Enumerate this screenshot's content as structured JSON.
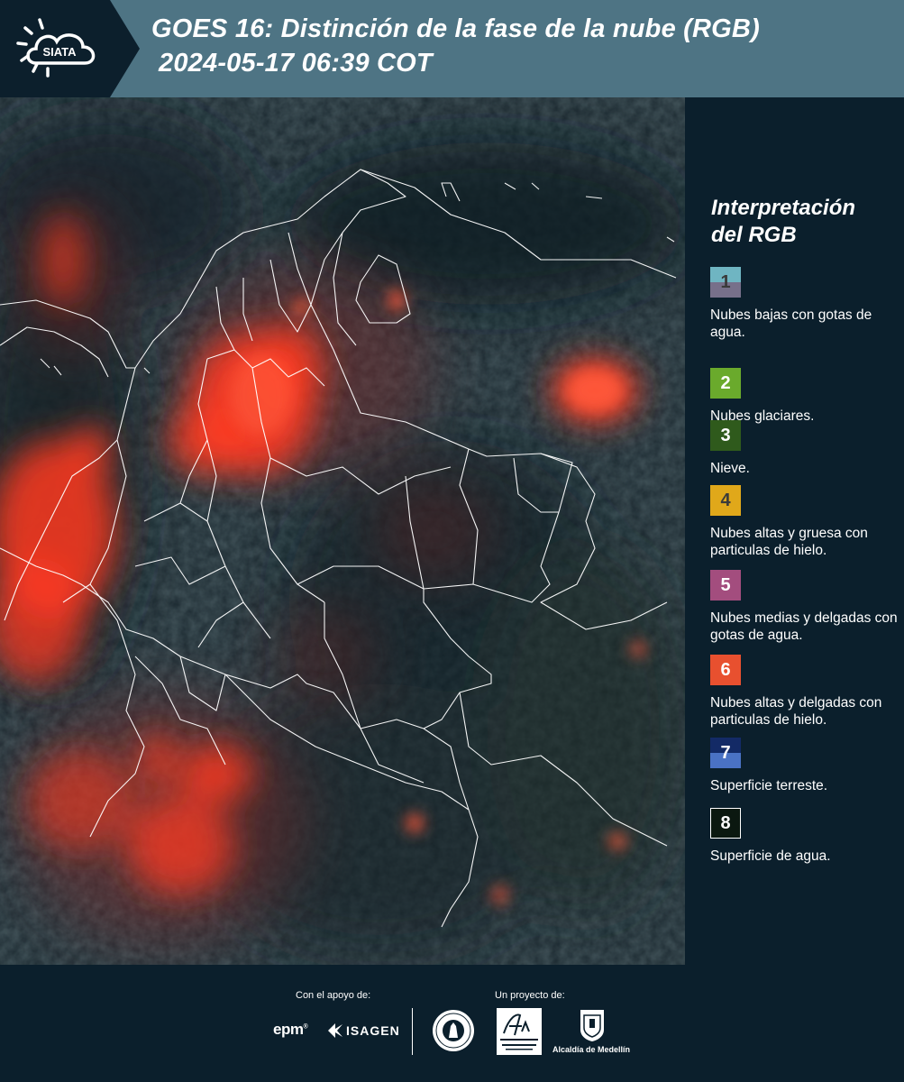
{
  "header": {
    "logo_text": "SIATA",
    "title_line1": "GOES 16: Distinción de la fase de la nube (RGB)",
    "title_line2": "2024-05-17 06:39 COT"
  },
  "legend": {
    "title": "Interpretación del RGB",
    "items": [
      {
        "number": "1",
        "label": "Nubes bajas con gotas de agua.",
        "colors": [
          "#6fb5c2",
          "#77708a"
        ],
        "text_color": "#3a3a3a"
      },
      {
        "number": "2",
        "label": "Nubes glaciares.",
        "colors": [
          "#6aaa2c"
        ],
        "text_color": "#ffffff"
      },
      {
        "number": "3",
        "label": "Nieve.",
        "colors": [
          "#2f5a1c"
        ],
        "text_color": "#ffffff"
      },
      {
        "number": "4",
        "label": "Nubes altas y gruesa con particulas de hielo.",
        "colors": [
          "#e0a81a"
        ],
        "text_color": "#3a3a3a"
      },
      {
        "number": "5",
        "label": "Nubes medias y delgadas con gotas de agua.",
        "colors": [
          "#a34d7e"
        ],
        "text_color": "#ffffff"
      },
      {
        "number": "6",
        "label": "Nubes altas y delgadas con particulas de hielo.",
        "colors": [
          "#e8502f"
        ],
        "text_color": "#ffffff"
      },
      {
        "number": "7",
        "label": "Superficie terreste.",
        "colors": [
          "#132a66",
          "#4a72c4"
        ],
        "text_color": "#ffffff"
      },
      {
        "number": "8",
        "label": "Superficie de agua.",
        "colors": [
          "#0b1810"
        ],
        "text_color": "#ffffff"
      }
    ]
  },
  "footer": {
    "support_label": "Con el apoyo de:",
    "project_label": "Un proyecto de:",
    "sponsors": [
      "epm",
      "ISAGEN"
    ],
    "partners": [
      "Universidad Nacional de Colombia",
      "Área Metropolitana Valle de Aburrá",
      "Alcaldía de Medellín"
    ],
    "alcaldia_text": "Alcaldía de Medellín"
  },
  "map": {
    "cloud_color": "#ff3b22",
    "background_color": "#1e2a30",
    "border_color": "#ffffff"
  }
}
